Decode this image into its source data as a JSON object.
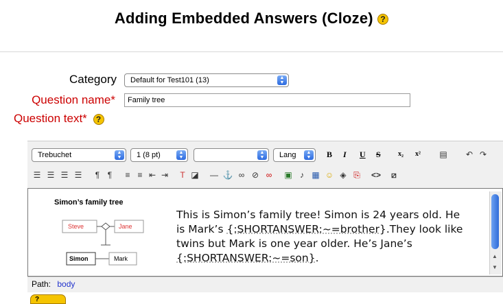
{
  "page": {
    "title": "Adding Embedded Answers (Cloze)"
  },
  "form": {
    "category_label": "Category",
    "category_value": "Default for Test101 (13)",
    "qname_label": "Question name",
    "qname_value": "Family tree",
    "qtext_label": "Question text",
    "required_mark": "*"
  },
  "toolbar": {
    "font_value": "Trebuchet",
    "size_value": "1 (8 pt)",
    "format_value": "",
    "lang_value": "Lang",
    "bold": "B",
    "italic": "I",
    "underline": "U",
    "strike": "S",
    "subscript": "x₂",
    "superscript": "x²"
  },
  "figure": {
    "title": "Simon’s family tree",
    "steve": "Steve",
    "jane": "Jane",
    "simon": "Simon",
    "mark": "Mark"
  },
  "editor_text": {
    "line1": "This is Simon’s family tree! Simon is 24 years old. He",
    "line2_pre": "is Mark’s ",
    "line2_code": "{:SHORTANSWER:~=brother}",
    "line2_post": ".They look like",
    "line3": "twins but Mark is one year older. He’s Jane’s",
    "line4_code": "{:SHORTANSWER:~=son}",
    "line4_post": "."
  },
  "path": {
    "label": "Path:",
    "link": "body"
  },
  "colors": {
    "required": "#cc0000",
    "link": "#2233cc",
    "help": "#f5c400"
  }
}
